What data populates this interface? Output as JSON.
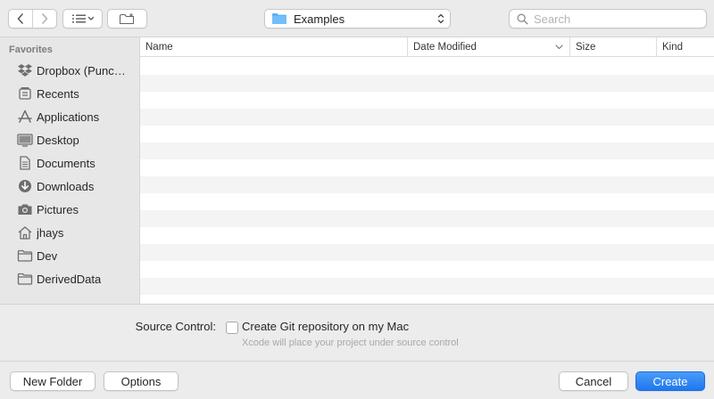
{
  "toolbar": {
    "back_icon": "chevron-left-icon",
    "forward_icon": "chevron-right-icon",
    "view_icon": "list-view-icon",
    "new_folder_icon": "new-folder-icon",
    "path_label": "Examples",
    "search_placeholder": "Search"
  },
  "sidebar": {
    "heading": "Favorites",
    "items": [
      {
        "label": "Dropbox (Punc…",
        "icon": "dropbox-icon"
      },
      {
        "label": "Recents",
        "icon": "recents-icon"
      },
      {
        "label": "Applications",
        "icon": "applications-icon"
      },
      {
        "label": "Desktop",
        "icon": "desktop-icon"
      },
      {
        "label": "Documents",
        "icon": "documents-icon"
      },
      {
        "label": "Downloads",
        "icon": "downloads-icon"
      },
      {
        "label": "Pictures",
        "icon": "pictures-icon"
      },
      {
        "label": "jhays",
        "icon": "home-icon"
      },
      {
        "label": "Dev",
        "icon": "folder-icon"
      },
      {
        "label": "DerivedData",
        "icon": "folder-icon"
      }
    ]
  },
  "filelist": {
    "columns": [
      "Name",
      "Date Modified",
      "Size",
      "Kind"
    ],
    "sorted_column": "Date Modified"
  },
  "accessory": {
    "source_control_label": "Source Control:",
    "git_checkbox_label": "Create Git repository on my Mac",
    "git_checked": false,
    "git_help": "Xcode will place your project under source control"
  },
  "buttons": {
    "new_folder": "New Folder",
    "options": "Options",
    "cancel": "Cancel",
    "create": "Create"
  },
  "colors": {
    "accent": "#1e77ef",
    "folder_blue": "#5ab0f5",
    "sidebar_icon": "#6e6e6e"
  }
}
